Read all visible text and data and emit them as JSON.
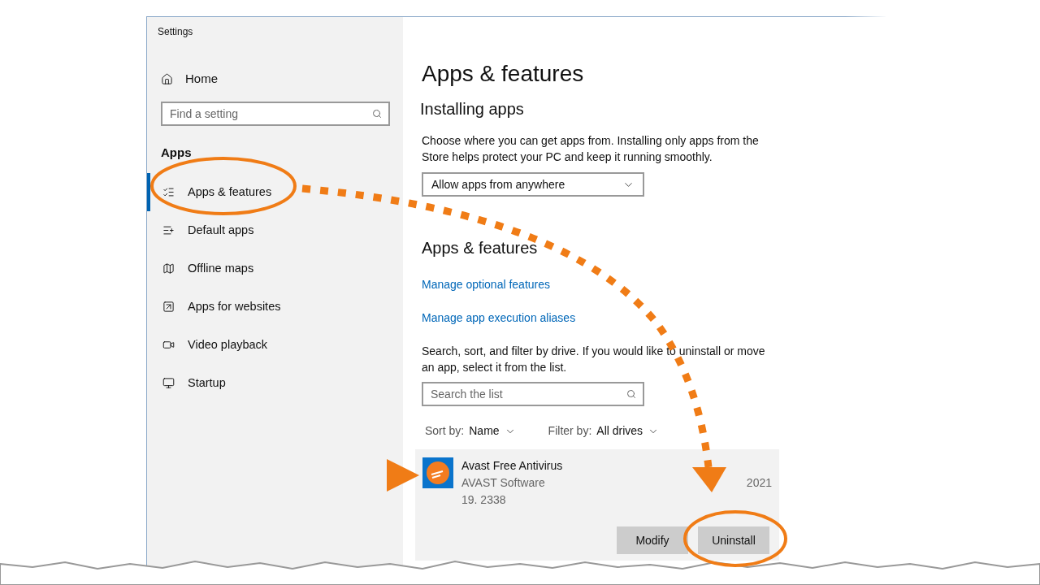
{
  "window": {
    "title": "Settings"
  },
  "sidebar": {
    "home": "Home",
    "search": {
      "placeholder": "Find a setting"
    },
    "section": "Apps",
    "items": [
      {
        "label": "Apps & features",
        "selected": true
      },
      {
        "label": "Default apps",
        "selected": false
      },
      {
        "label": "Offline maps",
        "selected": false
      },
      {
        "label": "Apps for websites",
        "selected": false
      },
      {
        "label": "Video playback",
        "selected": false
      },
      {
        "label": "Startup",
        "selected": false
      }
    ]
  },
  "main": {
    "title": "Apps & features",
    "installing": {
      "heading": "Installing apps",
      "description": "Choose where you can get apps from. Installing only apps from the Store helps protect your PC and keep it running smoothly.",
      "dropdown": {
        "value": "Allow apps from anywhere"
      }
    },
    "apps_features": {
      "heading": "Apps & features",
      "links": [
        "Manage optional features",
        "Manage app execution aliases"
      ],
      "description": "Search, sort, and filter by drive. If you would like to uninstall or move an app, select it from the list.",
      "search": {
        "placeholder": "Search the list"
      },
      "sort": {
        "label": "Sort by:",
        "value": "Name"
      },
      "filter": {
        "label": "Filter by:",
        "value": "All drives"
      },
      "apps": [
        {
          "name": "Avast Free Antivirus",
          "publisher": "AVAST Software",
          "version": "19. 2338",
          "date": "2021",
          "expanded": true,
          "buttons": [
            "Modify",
            "Uninstall"
          ]
        }
      ]
    }
  }
}
